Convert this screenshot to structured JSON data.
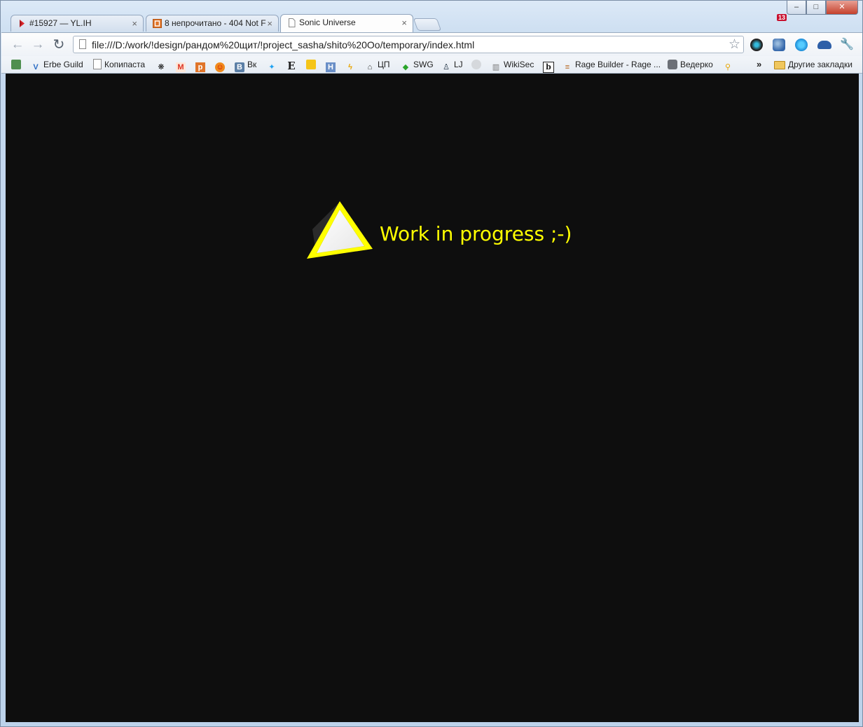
{
  "tabs": [
    {
      "title": "#15927 — YL.IH",
      "favicon": "red-gem-icon"
    },
    {
      "title": "8 непрочитано - 404 Not F",
      "favicon": "orange-square-icon"
    },
    {
      "title": "Sonic Universe",
      "favicon": "page-icon"
    }
  ],
  "window_controls": {
    "minimize": "–",
    "maximize": "□",
    "close": "✕"
  },
  "toolbar": {
    "url": "file:///D:/work/!design/рандом%20щит/!project_sasha/shito%20Oo/temporary/index.html",
    "notification_count": "13"
  },
  "bookmarks": {
    "items": [
      {
        "label": "",
        "icon": "cube-icon"
      },
      {
        "label": "Erbe Guild",
        "icon": "v-icon"
      },
      {
        "label": "Копипаста",
        "icon": "page-icon"
      },
      {
        "label": "",
        "icon": "paw-icon"
      },
      {
        "label": "",
        "icon": "m-icon"
      },
      {
        "label": "",
        "icon": "orange-square-icon"
      },
      {
        "label": "",
        "icon": "face-icon"
      },
      {
        "label": "Вк",
        "icon": "vk-icon"
      },
      {
        "label": "",
        "icon": "bird-icon"
      },
      {
        "label": "",
        "icon": "e-icon"
      },
      {
        "label": "",
        "icon": "grid-icon"
      },
      {
        "label": "",
        "icon": "h-icon"
      },
      {
        "label": "",
        "icon": "lightning-icon"
      },
      {
        "label": "ЦП",
        "icon": "network-icon"
      },
      {
        "label": "SWG",
        "icon": "gem-icon"
      },
      {
        "label": "LJ",
        "icon": "user-icon"
      },
      {
        "label": "",
        "icon": "disc-icon"
      },
      {
        "label": "WikiSec",
        "icon": "book-icon"
      },
      {
        "label": "",
        "icon": "b-icon"
      },
      {
        "label": "Rage Builder - Rage ...",
        "icon": "burger-icon"
      },
      {
        "label": "Ведерко",
        "icon": "bucket-icon"
      },
      {
        "label": "",
        "icon": "key-icon"
      }
    ],
    "overflow": "»",
    "other_bookmarks": "Другие закладки"
  },
  "content": {
    "message": "Work in progress ;-)"
  },
  "colors": {
    "page_background": "#0e0e0e",
    "message_color": "#ffff00"
  }
}
